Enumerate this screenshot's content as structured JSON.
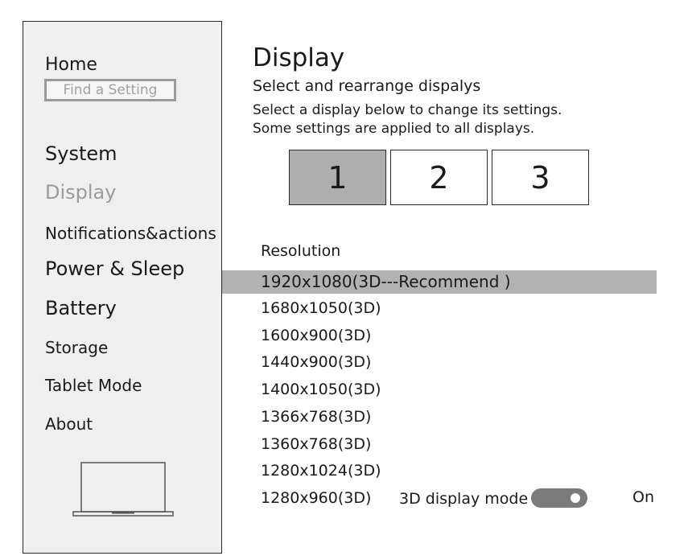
{
  "sidebar": {
    "home": "Home",
    "search_placeholder": "Find a Setting",
    "items": [
      {
        "label": "System"
      },
      {
        "label": "Display"
      },
      {
        "label": "Notifications&actions"
      },
      {
        "label": "Power & Sleep"
      },
      {
        "label": "Battery"
      },
      {
        "label": "Storage"
      },
      {
        "label": "Tablet Mode"
      },
      {
        "label": "About"
      }
    ],
    "active_item": "Display",
    "device_icon": "laptop-icon"
  },
  "main": {
    "title": "Display",
    "subtitle": "Select and rearrange dispalys",
    "desc_line1": "Select a display below to change its settings.",
    "desc_line2": "Some settings are applied to all displays.",
    "monitors": [
      "1",
      "2",
      "3"
    ],
    "selected_monitor": "1",
    "resolution_label": "Resolution",
    "resolutions": [
      "1920x1080(3D---Recommend )",
      "1680x1050(3D)",
      "1600x900(3D)",
      "1440x900(3D)",
      "1400x1050(3D)",
      "1366x768(3D)",
      "1360x768(3D)",
      "1280x1024(3D)",
      "1280x960(3D)"
    ],
    "selected_resolution": "1920x1080(3D---Recommend )",
    "mode_label": "3D display mode",
    "mode_state": "On",
    "mode_enabled": true
  },
  "colors": {
    "sidebar_bg": "#efefef",
    "selection": "#b2b2b2",
    "active_text": "#9b9b9b",
    "toggle_on": "#7b7b7b"
  }
}
